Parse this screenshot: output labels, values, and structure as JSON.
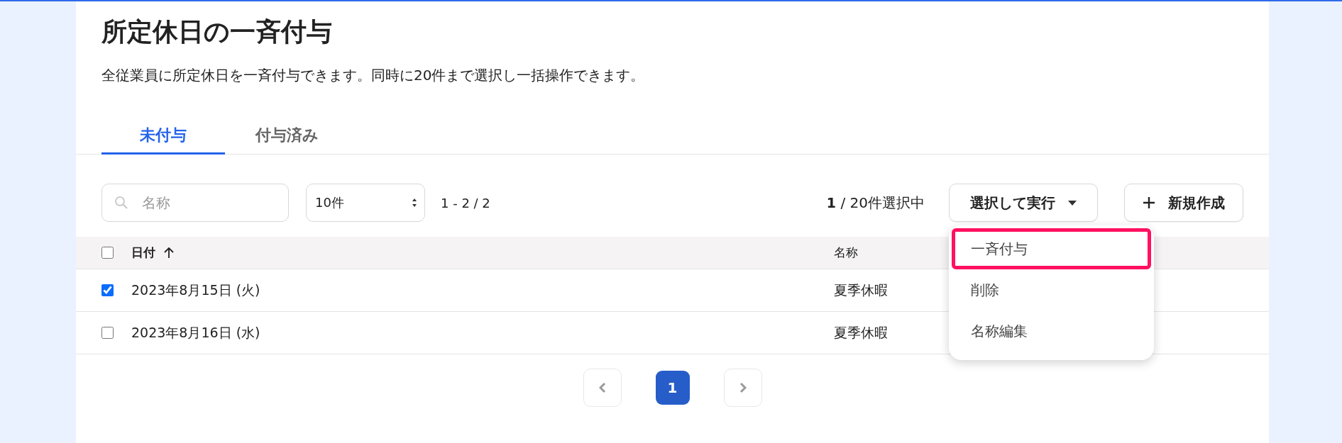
{
  "page": {
    "title": "所定休日の一斉付与",
    "description": "全従業員に所定休日を一斉付与できます。同時に20件まで選択し一括操作できます。"
  },
  "tabs": [
    {
      "label": "未付与",
      "selected": true
    },
    {
      "label": "付与済み",
      "selected": false
    }
  ],
  "toolbar": {
    "search": {
      "placeholder": "名称"
    },
    "page_size": "10件",
    "range": "1 - 2 / 2",
    "selection": "**1** / 20件選択中",
    "execute_button": "選択して実行",
    "new_button": "新規作成"
  },
  "menu": {
    "expanded": true,
    "items": [
      {
        "label": "一斉付与",
        "highlighted": true
      },
      {
        "label": "削除",
        "highlighted": false
      },
      {
        "label": "名称編集",
        "highlighted": false
      }
    ]
  },
  "table": {
    "header_checked": false,
    "columns": [
      {
        "label": "日付",
        "sorted": true
      },
      {
        "label": "名称",
        "sorted": false
      }
    ],
    "rows": [
      {
        "checked": true,
        "cells": [
          "2023年8月15日 (火)",
          "夏季休暇"
        ]
      },
      {
        "checked": false,
        "cells": [
          "2023年8月16日 (水)",
          "夏季休暇"
        ]
      }
    ]
  },
  "pagination": {
    "pages": [
      {
        "label": "1",
        "selected": true
      }
    ]
  }
}
